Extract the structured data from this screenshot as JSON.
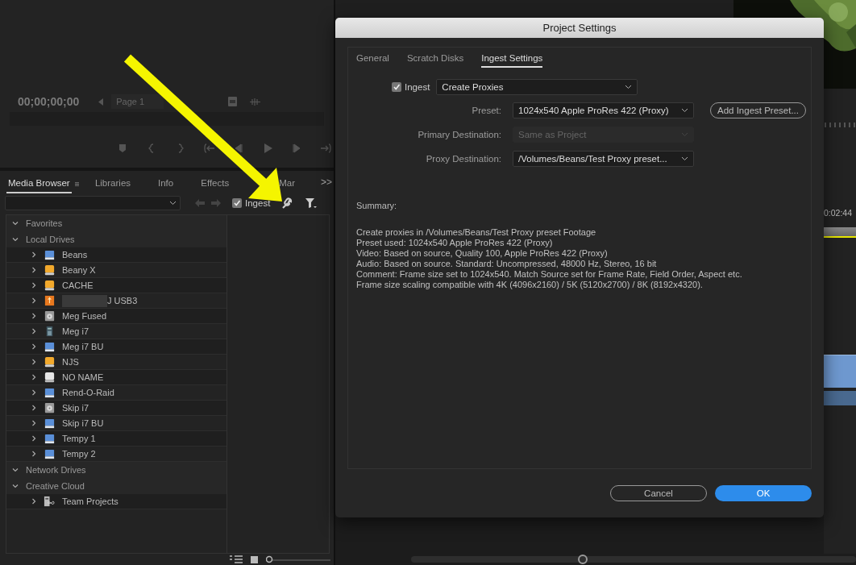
{
  "source_monitor": {
    "timecode": "00;00;00;00",
    "page": "Page 1"
  },
  "panel": {
    "tabs": [
      {
        "label": "Media Browser",
        "selected": true
      },
      {
        "label": "Libraries",
        "selected": false
      },
      {
        "label": "Info",
        "selected": false
      },
      {
        "label": "Effects",
        "selected": false
      },
      {
        "label": "Mar",
        "selected": false
      }
    ],
    "overflow": ">>",
    "ingest": {
      "label": "Ingest",
      "checked": true
    },
    "zoom": {
      "level": 0
    }
  },
  "tree": [
    {
      "label": "Favorites",
      "expanded": true
    },
    {
      "label": "Local Drives",
      "expanded": true,
      "children": [
        {
          "label": "Beans",
          "kind": "external",
          "expanded": false
        },
        {
          "label": "Beany X",
          "kind": "internal",
          "expanded": false
        },
        {
          "label": "CACHE",
          "kind": "internal",
          "expanded": false
        },
        {
          "label": "J USB3",
          "kind": "usb",
          "expanded": false,
          "redacted": true
        },
        {
          "label": "Meg Fused",
          "kind": "disk",
          "expanded": false
        },
        {
          "label": "Meg i7",
          "kind": "tower",
          "expanded": false
        },
        {
          "label": "Meg i7 BU",
          "kind": "external",
          "expanded": false
        },
        {
          "label": "NJS",
          "kind": "internal",
          "expanded": false
        },
        {
          "label": "NO NAME",
          "kind": "removable",
          "expanded": false
        },
        {
          "label": "Rend-O-Raid",
          "kind": "external",
          "expanded": false
        },
        {
          "label": "Skip i7",
          "kind": "disk",
          "expanded": false
        },
        {
          "label": "Skip i7 BU",
          "kind": "external",
          "expanded": false
        },
        {
          "label": "Tempy 1",
          "kind": "external",
          "expanded": false
        },
        {
          "label": "Tempy 2",
          "kind": "external",
          "expanded": false
        }
      ]
    },
    {
      "label": "Network Drives",
      "expanded": true
    },
    {
      "label": "Creative Cloud",
      "expanded": true,
      "children": [
        {
          "label": "Team Projects",
          "kind": "team",
          "expanded": false
        }
      ]
    }
  ],
  "timeline": {
    "timecode": "0:02:44"
  },
  "dialog": {
    "title": "Project Settings",
    "tabs": [
      {
        "label": "General",
        "selected": false
      },
      {
        "label": "Scratch Disks",
        "selected": false
      },
      {
        "label": "Ingest Settings",
        "selected": true
      }
    ],
    "ingest": {
      "label": "Ingest",
      "checked": true,
      "value": "Create Proxies"
    },
    "fields": [
      {
        "label": "Preset:",
        "value": "1024x540 Apple ProRes 422 (Proxy)",
        "disabled": false
      },
      {
        "label": "Primary Destination:",
        "value": "Same as Project",
        "disabled": true
      },
      {
        "label": "Proxy Destination:",
        "value": "/Volumes/Beans/Test Proxy preset...",
        "disabled": false
      }
    ],
    "add_preset_button": "Add Ingest Preset...",
    "summary_label": "Summary:",
    "summary_lines": [
      "Create proxies in /Volumes/Beans/Test Proxy preset Footage",
      "Preset used: 1024x540 Apple ProRes 422 (Proxy)",
      "Video: Based on source, Quality 100, Apple ProRes 422 (Proxy)",
      "Audio: Based on source. Standard: Uncompressed, 48000 Hz, Stereo, 16 bit",
      "Comment: Frame size set to 1024x540. Match Source set for Frame Rate, Field Order, Aspect etc.",
      "Frame size scaling compatible with 4K (4096x2160) / 5K (5120x2700) / 8K (8192x4320)."
    ],
    "buttons": [
      {
        "label": "Cancel",
        "kind": "secondary"
      },
      {
        "label": "OK",
        "kind": "primary"
      }
    ]
  }
}
